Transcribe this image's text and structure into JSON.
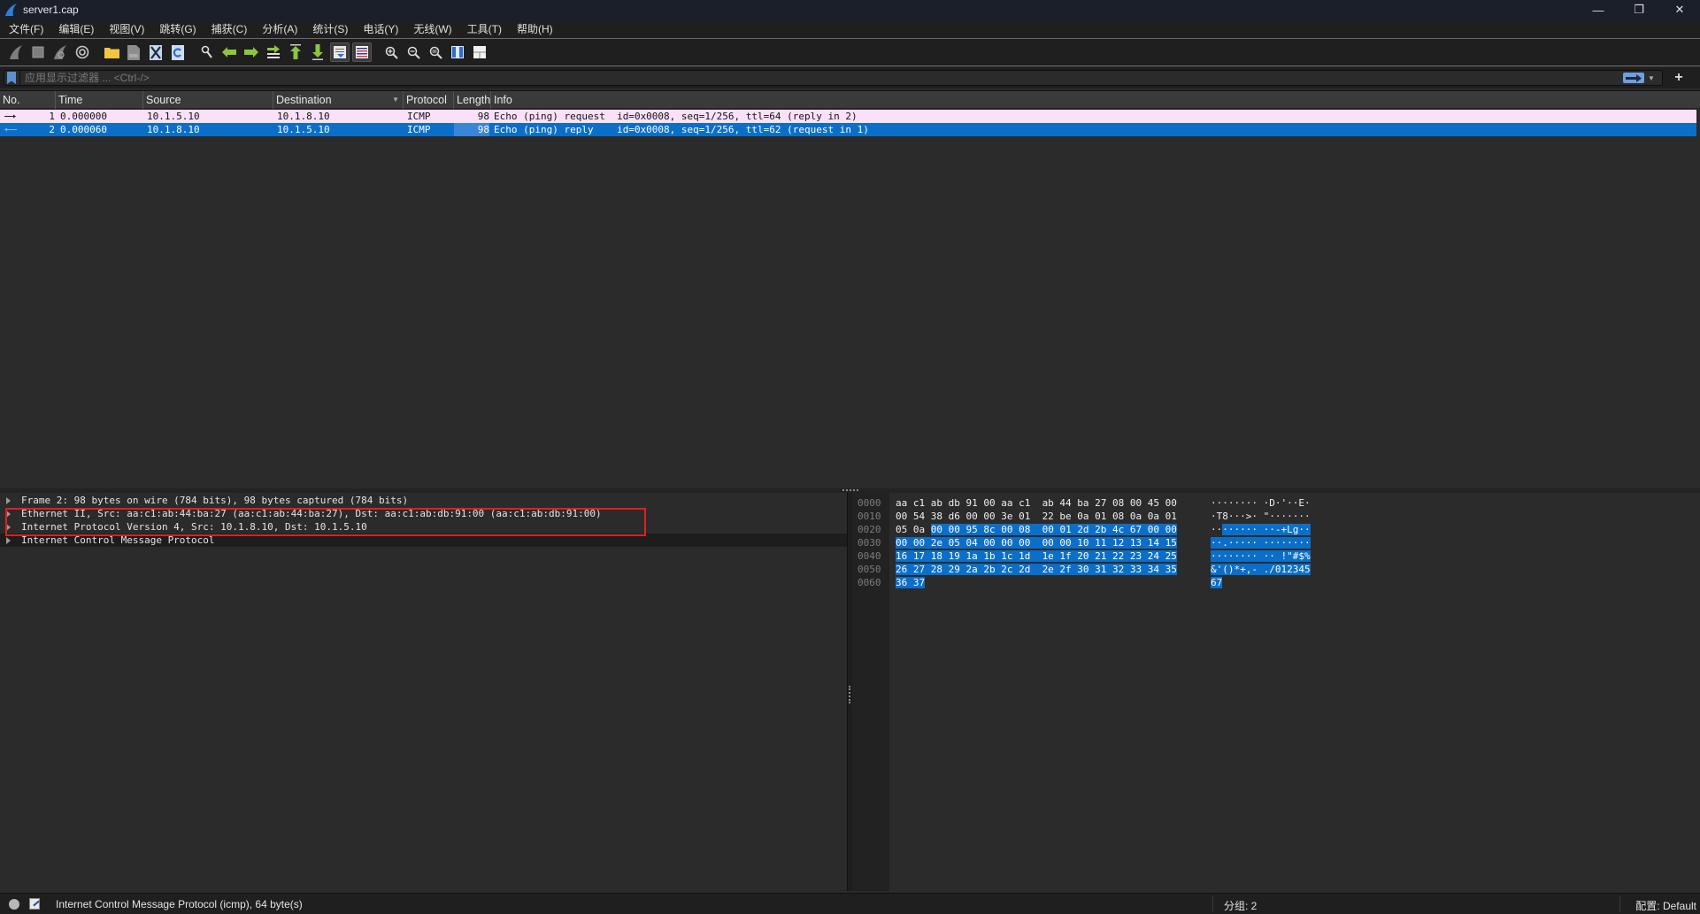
{
  "window": {
    "title": "server1.cap",
    "controls": {
      "minimize": "—",
      "restore": "❐",
      "close": "✕"
    }
  },
  "menu": [
    "文件(F)",
    "编辑(E)",
    "视图(V)",
    "跳转(G)",
    "捕获(C)",
    "分析(A)",
    "统计(S)",
    "电话(Y)",
    "无线(W)",
    "工具(T)",
    "帮助(H)"
  ],
  "toolbar": {
    "buttons": [
      {
        "name": "start-capture-icon"
      },
      {
        "name": "stop-capture-icon"
      },
      {
        "name": "restart-capture-icon"
      },
      {
        "name": "capture-options-icon"
      },
      {
        "name": "open-file-icon"
      },
      {
        "name": "save-file-icon"
      },
      {
        "name": "close-file-icon"
      },
      {
        "name": "reload-file-icon"
      },
      {
        "name": "find-packet-icon"
      },
      {
        "name": "go-back-icon"
      },
      {
        "name": "go-forward-icon"
      },
      {
        "name": "go-to-packet-icon"
      },
      {
        "name": "go-first-icon"
      },
      {
        "name": "go-last-icon"
      },
      {
        "name": "autoscroll-icon"
      },
      {
        "name": "colorize-icon"
      },
      {
        "name": "zoom-in-icon"
      },
      {
        "name": "zoom-out-icon"
      },
      {
        "name": "zoom-normal-icon"
      },
      {
        "name": "resize-columns-icon"
      },
      {
        "name": "layout-icon"
      }
    ]
  },
  "filter": {
    "placeholder": "应用显示过滤器 ... <Ctrl-/>",
    "value": "",
    "add_label": "+"
  },
  "packet_list": {
    "columns": [
      "No.",
      "Time",
      "Source",
      "Destination",
      "Protocol",
      "Length",
      "Info"
    ],
    "rows": [
      {
        "no": "1",
        "time": "0.000000",
        "source": "10.1.5.10",
        "destination": "10.1.8.10",
        "protocol": "ICMP",
        "length": "98",
        "info": "Echo (ping) request  id=0x0008, seq=1/256, ttl=64 (reply in 2)",
        "direction": "request",
        "selected": false
      },
      {
        "no": "2",
        "time": "0.000060",
        "source": "10.1.8.10",
        "destination": "10.1.5.10",
        "protocol": "ICMP",
        "length": "98",
        "info": "Echo (ping) reply    id=0x0008, seq=1/256, ttl=62 (request in 1)",
        "direction": "reply",
        "selected": true
      }
    ]
  },
  "details": {
    "rows": [
      "Frame 2: 98 bytes on wire (784 bits), 98 bytes captured (784 bits)",
      "Ethernet II, Src: aa:c1:ab:44:ba:27 (aa:c1:ab:44:ba:27), Dst: aa:c1:ab:db:91:00 (aa:c1:ab:db:91:00)",
      "Internet Protocol Version 4, Src: 10.1.8.10, Dst: 10.1.5.10",
      "Internet Control Message Protocol"
    ],
    "selected_index": 3
  },
  "bytes": {
    "lines": [
      {
        "offset": "0000",
        "hex_pre": "aa c1 ab db 91 00 aa c1  ab 44 ba 27 08 00 45 00",
        "hex_hl": "",
        "ascii_pre": "········ ·D·'··E·",
        "ascii_hl": ""
      },
      {
        "offset": "0010",
        "hex_pre": "00 54 38 d6 00 00 3e 01  22 be 0a 01 08 0a 0a 01",
        "hex_hl": "",
        "ascii_pre": "·T8···>· \"·······",
        "ascii_hl": ""
      },
      {
        "offset": "0020",
        "hex_pre": "05 0a ",
        "hex_hl": "00 00 95 8c 00 08  00 01 2d 2b 4c 67 00 00",
        "ascii_pre": "··",
        "ascii_hl": "······ ··-+Lg··"
      },
      {
        "offset": "0030",
        "hex_pre": "",
        "hex_hl": "00 00 2e 05 04 00 00 00  00 00 10 11 12 13 14 15",
        "ascii_pre": "",
        "ascii_hl": "··.····· ········"
      },
      {
        "offset": "0040",
        "hex_pre": "",
        "hex_hl": "16 17 18 19 1a 1b 1c 1d  1e 1f 20 21 22 23 24 25",
        "ascii_pre": "",
        "ascii_hl": "········ ·· !\"#$%"
      },
      {
        "offset": "0050",
        "hex_pre": "",
        "hex_hl": "26 27 28 29 2a 2b 2c 2d  2e 2f 30 31 32 33 34 35",
        "ascii_pre": "",
        "ascii_hl": "&'()*+,- ./012345"
      },
      {
        "offset": "0060",
        "hex_pre": "",
        "hex_hl": "36 37",
        "ascii_pre": "",
        "ascii_hl": "67"
      }
    ]
  },
  "status": {
    "field_info": "Internet Control Message Protocol (icmp), 64 byte(s)",
    "packets": "分组: 2",
    "profile": "配置: Default"
  },
  "colors": {
    "request_row_bg": "#fae0f8",
    "selected_row_bg": "#0b6fc9",
    "highlight_box": "#e0201e"
  }
}
